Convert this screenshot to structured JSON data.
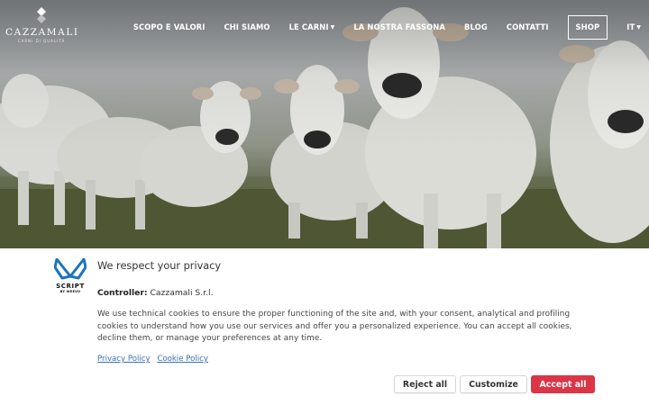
{
  "brand": {
    "logo_text": "CAZZAMALI",
    "logo_subtext": "CARNI DI QUALITÀ"
  },
  "nav": {
    "items": [
      {
        "label": "SCOPO E VALORI",
        "dropdown": false
      },
      {
        "label": "CHI SIAMO",
        "dropdown": false
      },
      {
        "label": "LE CARNI",
        "dropdown": true
      },
      {
        "label": "LA NOSTRA FASSONA",
        "dropdown": false
      },
      {
        "label": "BLOG",
        "dropdown": false
      },
      {
        "label": "CONTATTI",
        "dropdown": false
      },
      {
        "label": "SHOP",
        "dropdown": false
      },
      {
        "label": "IT",
        "dropdown": true
      }
    ]
  },
  "hero": {
    "icon": "cattle-photo"
  },
  "cookie": {
    "vendor_name": "SCRIPT",
    "vendor_by": "BY WEEVO",
    "title": "We respect your privacy",
    "controller_label": "Controller:",
    "controller_value": "Cazzamali S.r.l.",
    "body": "We use technical cookies to ensure the proper functioning of the site and, with your consent, analytical and profiling cookies to understand how you use our services and offer you a personalized experience. You can accept all cookies, decline them, or manage your preferences at any time.",
    "links": {
      "privacy": "Privacy Policy",
      "cookie": "Cookie Policy"
    },
    "buttons": {
      "reject": "Reject all",
      "customize": "Customize",
      "accept": "Accept all"
    },
    "colors": {
      "accent": "#dc3545",
      "link": "#3b6fb6",
      "vendor_logo": "#1b75bc"
    }
  }
}
